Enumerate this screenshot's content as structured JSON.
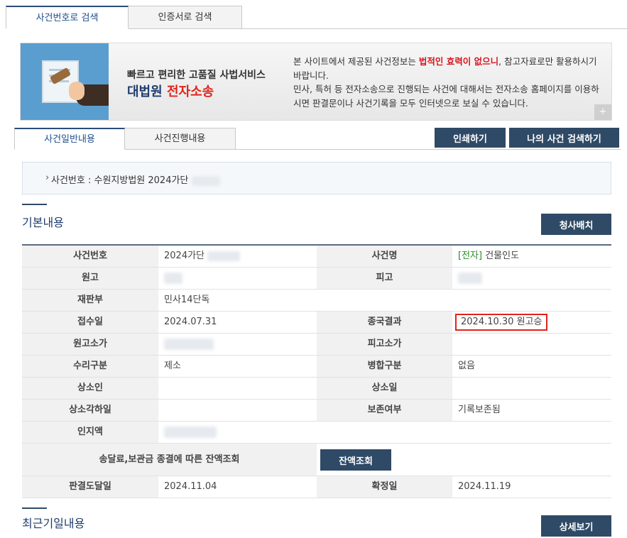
{
  "top_tabs": {
    "active": "사건번호로 검색",
    "inactive": "인증서로 검색"
  },
  "banner": {
    "title_line1": "빠르고 편리한 고품질 사법서비스",
    "title_line2_prefix": "대법원",
    "title_line2_highlight": "전자소송",
    "desc_part1": "본 사이트에서 제공된 사건정보는 ",
    "desc_warning": "법적인 효력이 없으니",
    "desc_part2": ", 참고자료로만 활용하시기 바랍니다.",
    "desc_line3": "민사, 특허 등 전자소송으로 진행되는 사건에 대해서는 전자소송 홈페이지를 이용하시면 판결문이나 사건기록을 모두 인터넷으로 보실 수 있습니다.",
    "plus": "+"
  },
  "sub_tabs": {
    "active": "사건일반내용",
    "inactive": "사건진행내용"
  },
  "buttons": {
    "print": "인쇄하기",
    "my_case_search": "나의 사건 검색하기",
    "delivery": "청사배치",
    "balance": "잔액조회",
    "detail": "상세보기"
  },
  "case_box": {
    "bullet": "›",
    "label": "사건번호 : 수원지방법원 2024가단"
  },
  "sections": {
    "basic": "기본내용",
    "recent": "최근기일내용"
  },
  "table": {
    "case_no_label": "사건번호",
    "case_no_value": "2024가단",
    "case_name_label": "사건명",
    "case_name_tag": "[전자]",
    "case_name_value": " 건물인도",
    "plaintiff_label": "원고",
    "defendant_label": "피고",
    "court_label": "재판부",
    "court_value": "민사14단독",
    "receipt_label": "접수일",
    "receipt_value": "2024.07.31",
    "result_label": "종국결과",
    "result_value": "2024.10.30 원고승",
    "plaintiff_value_label": "원고소가",
    "defendant_value_label": "피고소가",
    "acceptance_label": "수리구분",
    "acceptance_value": "제소",
    "merge_label": "병합구분",
    "merge_value": "없음",
    "appellant_label": "상소인",
    "appeal_date_label": "상소일",
    "appeal_dismiss_label": "상소각하일",
    "preserve_label": "보존여부",
    "preserve_value": "기록보존됨",
    "stamp_label": "인지액",
    "fee_balance_label": "송달료,보관금 종결에 따른 잔액조회",
    "judgment_delivery_label": "판결도달일",
    "judgment_delivery_value": "2024.11.04",
    "finalize_label": "확정일",
    "finalize_value": "2024.11.19"
  },
  "colors": {
    "navy": "#2f4a66",
    "accent_red": "#e0241b",
    "green": "#2a8c2a"
  }
}
